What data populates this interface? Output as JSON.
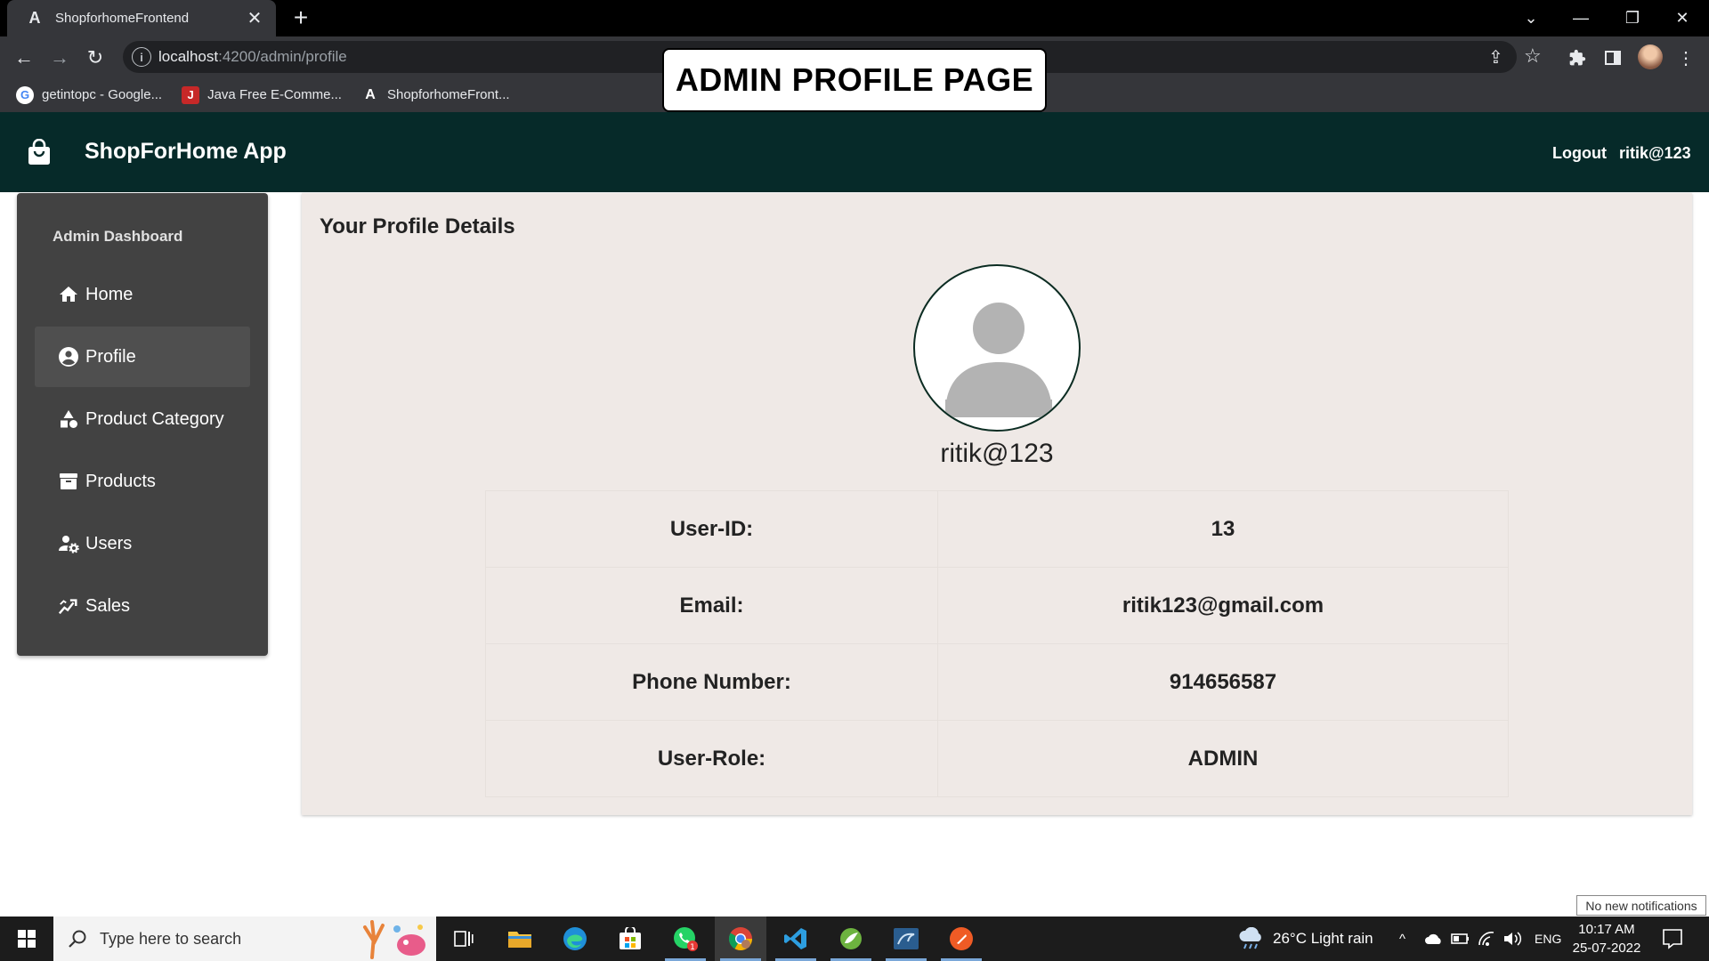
{
  "browser": {
    "tab_title": "ShopforhomeFrontend",
    "tab_favicon": "A",
    "url_host": "localhost",
    "url_path": ":4200/admin/profile",
    "bookmarks": [
      {
        "label": "getintopc - Google...",
        "icon": "google-icon"
      },
      {
        "label": "Java Free E-Comme...",
        "icon": "java-icon"
      },
      {
        "label": "ShopforhomeFront...",
        "icon": "angular-icon"
      }
    ]
  },
  "overlay": {
    "title": "ADMIN PROFILE PAGE"
  },
  "header": {
    "brand": "ShopForHome App",
    "logout": "Logout",
    "user": "ritik@123",
    "bg_color": "#062a29"
  },
  "sidebar": {
    "heading": "Admin Dashboard",
    "items": [
      {
        "label": "Home",
        "icon": "home-icon"
      },
      {
        "label": "Profile",
        "icon": "account-circle-icon",
        "active": true
      },
      {
        "label": "Product Category",
        "icon": "category-icon"
      },
      {
        "label": "Products",
        "icon": "inventory-icon"
      },
      {
        "label": "Users",
        "icon": "manage-accounts-icon"
      },
      {
        "label": "Sales",
        "icon": "trending-up-icon"
      }
    ]
  },
  "profile": {
    "title": "Your Profile Details",
    "username": "ritik@123",
    "rows": [
      {
        "label": "User-ID:",
        "value": "13"
      },
      {
        "label": "Email:",
        "value": "ritik123@gmail.com"
      },
      {
        "label": "Phone Number:",
        "value": "914656587"
      },
      {
        "label": "User-Role:",
        "value": "ADMIN"
      }
    ]
  },
  "taskbar": {
    "search_placeholder": "Type here to search",
    "weather": "26°C  Light rain",
    "lang": "ENG",
    "time": "10:17 AM",
    "date": "25-07-2022",
    "notification_tip": "No new notifications"
  }
}
